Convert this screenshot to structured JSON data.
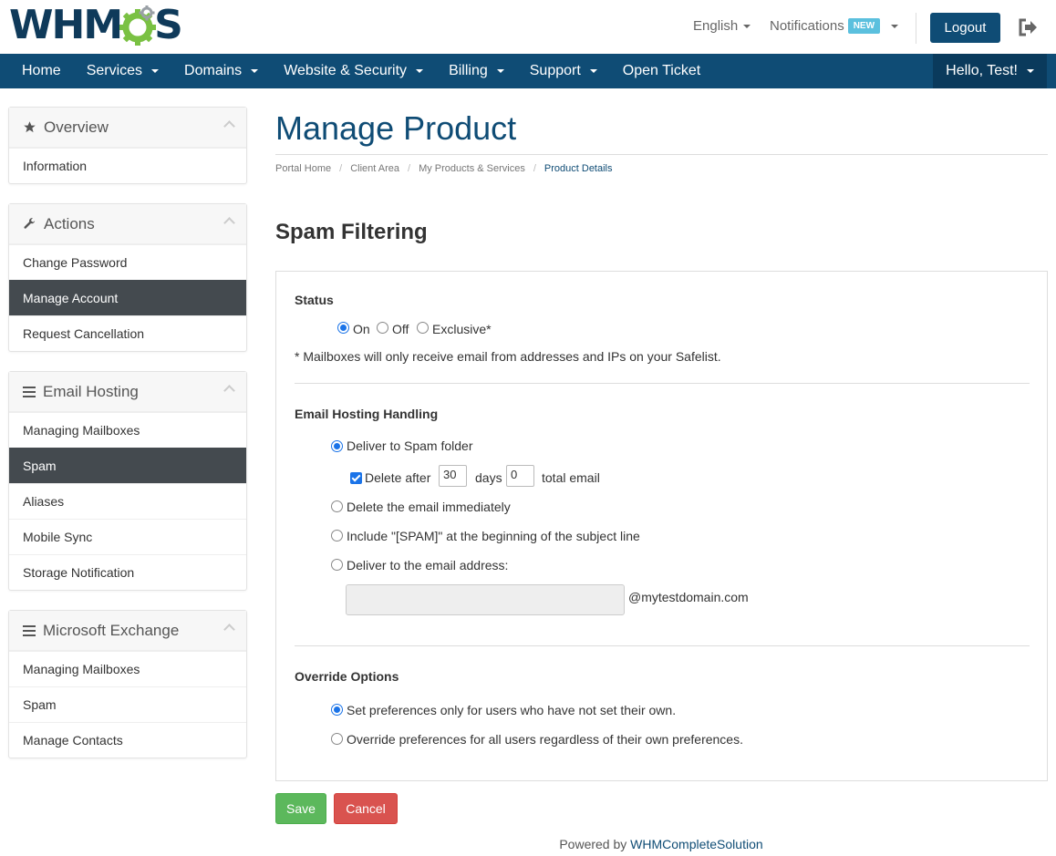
{
  "brand": {
    "logo_left": "WHM",
    "logo_right": "S"
  },
  "topbar": {
    "language": "English",
    "notifications": "Notifications",
    "notifications_badge": "NEW",
    "logout": "Logout"
  },
  "nav": {
    "items": [
      "Home",
      "Services",
      "Domains",
      "Website & Security",
      "Billing",
      "Support",
      "Open Ticket"
    ],
    "user_menu": "Hello, Test!"
  },
  "sidebar": {
    "overview": {
      "title": "Overview",
      "items": [
        "Information"
      ]
    },
    "actions": {
      "title": "Actions",
      "items": [
        "Change Password",
        "Manage Account",
        "Request Cancellation"
      ]
    },
    "email_hosting": {
      "title": "Email Hosting",
      "items": [
        "Managing Mailboxes",
        "Spam",
        "Aliases",
        "Mobile Sync",
        "Storage Notification"
      ]
    },
    "exchange": {
      "title": "Microsoft Exchange",
      "items": [
        "Managing Mailboxes",
        "Spam",
        "Manage Contacts"
      ]
    }
  },
  "page": {
    "title": "Manage Product",
    "breadcrumb": [
      "Portal Home",
      "Client Area",
      "My Products & Services",
      "Product Details"
    ],
    "section_title": "Spam Filtering"
  },
  "form": {
    "status_label": "Status",
    "status_options": [
      "On",
      "Off",
      "Exclusive*"
    ],
    "status_selected": "On",
    "status_note": "* Mailboxes will only receive email from addresses and IPs on your Safelist.",
    "handling_label": "Email Hosting Handling",
    "handling_options": [
      "Deliver to Spam folder",
      "Delete the email immediately",
      "Include \"[SPAM]\" at the beginning of the subject line",
      "Deliver to the email address:"
    ],
    "handling_selected": "Deliver to Spam folder",
    "delete_after_label": "Delete after",
    "delete_after_checked": true,
    "delete_after_days": "30",
    "days_label": "days",
    "total_email_value": "0",
    "total_email_label": "total email",
    "email_address_value": "",
    "email_domain_suffix": "@mytestdomain.com",
    "override_label": "Override Options",
    "override_options": [
      "Set preferences only for users who have not set their own.",
      "Override preferences for all users regardless of their own preferences."
    ],
    "override_selected": "Set preferences only for users who have not set their own."
  },
  "buttons": {
    "save": "Save",
    "cancel": "Cancel"
  },
  "footer": {
    "prefix": "Powered by",
    "link": "WHMCompleteSolution"
  },
  "colors": {
    "brand_blue": "#0f4c75",
    "nav_active": "#444a4f",
    "save_green": "#5cb85c",
    "cancel_red": "#d9534f",
    "badge_blue": "#5bc0de",
    "logo_green": "#7ac143"
  }
}
